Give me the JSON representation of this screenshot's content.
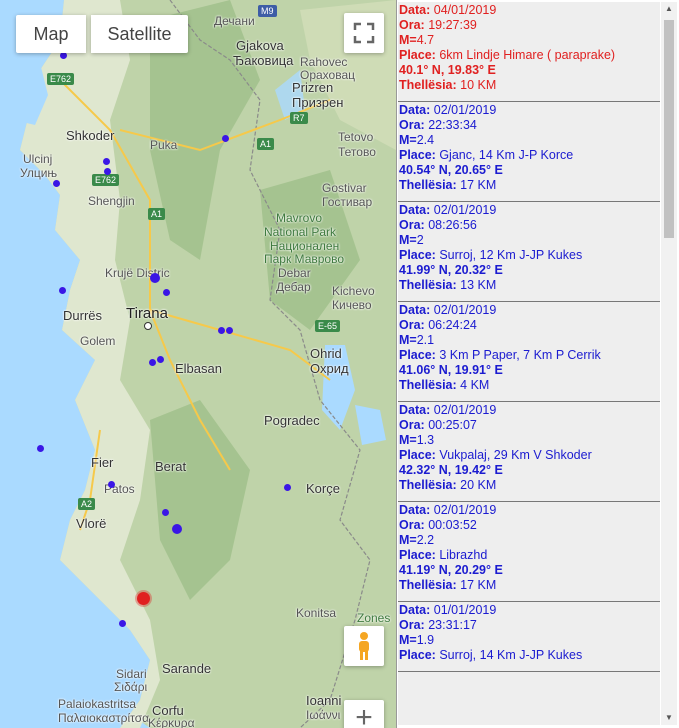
{
  "map": {
    "type_controls": {
      "map": "Map",
      "satellite": "Satellite"
    },
    "zoom_in_label": "+",
    "labels": [
      {
        "name": "place-label-gjakova",
        "text": "Gjakova"
      },
      {
        "name": "place-label-gjakova-cyr",
        "text": "Ђаковица"
      },
      {
        "name": "place-label-decani",
        "text": "Дечани"
      },
      {
        "name": "place-label-rahovec",
        "text": "Rahovec"
      },
      {
        "name": "place-label-rahovec-cyr",
        "text": "Ораховац"
      },
      {
        "name": "place-label-prizren",
        "text": "Prizren"
      },
      {
        "name": "place-label-prizren-cyr",
        "text": "Призрен"
      },
      {
        "name": "place-label-shkoder",
        "text": "Shkoder"
      },
      {
        "name": "place-label-puka",
        "text": "Puka"
      },
      {
        "name": "place-label-ulcinj",
        "text": "Ulcinj"
      },
      {
        "name": "place-label-ulcinj-cyr",
        "text": "Улцињ"
      },
      {
        "name": "place-label-shengjin",
        "text": "Shengjin"
      },
      {
        "name": "place-label-tetovo",
        "text": "Tetovo"
      },
      {
        "name": "place-label-tetovo-cyr",
        "text": "Тетово"
      },
      {
        "name": "place-label-gostivar",
        "text": "Gostivar"
      },
      {
        "name": "place-label-gostivar-cyr",
        "text": "Гостивар"
      },
      {
        "name": "place-label-mavrovo",
        "text": "Mavrovo"
      },
      {
        "name": "place-label-national-park",
        "text": "National Park"
      },
      {
        "name": "place-label-natsionalen",
        "text": "Национален"
      },
      {
        "name": "place-label-park-mavrovo",
        "text": "Парк Маврово"
      },
      {
        "name": "place-label-debar",
        "text": "Debar"
      },
      {
        "name": "place-label-debar-cyr",
        "text": "Дебар"
      },
      {
        "name": "place-label-kruje",
        "text": "Krujë Distric"
      },
      {
        "name": "place-label-kichevo",
        "text": "Kichevo"
      },
      {
        "name": "place-label-kichevo-cyr",
        "text": "Кичево"
      },
      {
        "name": "place-label-durres",
        "text": "Durrës"
      },
      {
        "name": "place-label-tirana",
        "text": "Tirana"
      },
      {
        "name": "place-label-golem",
        "text": "Golem"
      },
      {
        "name": "place-label-ohrid",
        "text": "Ohrid"
      },
      {
        "name": "place-label-ohrid-cyr",
        "text": "Охрид"
      },
      {
        "name": "place-label-elbasan",
        "text": "Elbasan"
      },
      {
        "name": "place-label-pogradec",
        "text": "Pogradec"
      },
      {
        "name": "place-label-fier",
        "text": "Fier"
      },
      {
        "name": "place-label-berat",
        "text": "Berat"
      },
      {
        "name": "place-label-patos",
        "text": "Patos"
      },
      {
        "name": "place-label-korce",
        "text": "Korçe"
      },
      {
        "name": "place-label-vlore",
        "text": "Vlorë"
      },
      {
        "name": "place-label-konitsa",
        "text": "Konitsa"
      },
      {
        "name": "place-label-zones",
        "text": "Zones"
      },
      {
        "name": "place-label-sidari",
        "text": "Sidari"
      },
      {
        "name": "place-label-sidari-gr",
        "text": "Σιδάρι"
      },
      {
        "name": "place-label-sarande",
        "text": "Sarande"
      },
      {
        "name": "place-label-palaiokastritsa",
        "text": "Palaiokastritsa"
      },
      {
        "name": "place-label-palaiokastritsa-gr",
        "text": "Παλαιοκαστρίτσα"
      },
      {
        "name": "place-label-corfu",
        "text": "Corfu"
      },
      {
        "name": "place-label-kerkyra",
        "text": "Κέρκυρα"
      },
      {
        "name": "place-label-ioanni",
        "text": "Ioanni"
      },
      {
        "name": "place-label-ioanni-gr",
        "text": "Ιωάννι"
      }
    ],
    "road_labels": [
      {
        "name": "road-m9",
        "text": "M9"
      },
      {
        "name": "road-e762-north",
        "text": "E762"
      },
      {
        "name": "road-r7",
        "text": "R7"
      },
      {
        "name": "road-a1-east",
        "text": "A1"
      },
      {
        "name": "road-e762-south",
        "text": "E762"
      },
      {
        "name": "road-a1-west",
        "text": "A1"
      },
      {
        "name": "road-e65",
        "text": "E-65"
      },
      {
        "name": "road-a2",
        "text": "A2"
      }
    ]
  },
  "events": [
    {
      "highlight": true,
      "data_label": "Data:",
      "data": "04/01/2019",
      "ora_label": "Ora:",
      "ora": "19:27:39",
      "m_label": "M=",
      "m": "4.7",
      "place_label": "Place:",
      "place": "6km Lindje Himare ( paraprake)",
      "coords": "40.1° N, 19.83° E",
      "depth_label": "Thellësia:",
      "depth": "10 KM"
    },
    {
      "highlight": false,
      "data_label": "Data:",
      "data": "02/01/2019",
      "ora_label": "Ora:",
      "ora": "22:33:34",
      "m_label": "M=",
      "m": "2.4",
      "place_label": "Place:",
      "place": "Gjanc, 14 Km J-P Korce",
      "coords": "40.54° N, 20.65° E",
      "depth_label": "Thellësia:",
      "depth": "17 KM"
    },
    {
      "highlight": false,
      "data_label": "Data:",
      "data": "02/01/2019",
      "ora_label": "Ora:",
      "ora": "08:26:56",
      "m_label": "M=",
      "m": "2",
      "place_label": "Place:",
      "place": "Surroj, 12 Km J-JP Kukes",
      "coords": "41.99° N, 20.32° E",
      "depth_label": "Thellësia:",
      "depth": "13 KM"
    },
    {
      "highlight": false,
      "data_label": "Data:",
      "data": "02/01/2019",
      "ora_label": "Ora:",
      "ora": "06:24:24",
      "m_label": "M=",
      "m": "2.1",
      "place_label": "Place:",
      "place": "3 Km P Paper, 7 Km P Cerrik",
      "coords": "41.06° N, 19.91° E",
      "depth_label": "Thellësia:",
      "depth": "4 KM"
    },
    {
      "highlight": false,
      "data_label": "Data:",
      "data": "02/01/2019",
      "ora_label": "Ora:",
      "ora": "00:25:07",
      "m_label": "M=",
      "m": "1.3",
      "place_label": "Place:",
      "place": "Vukpalaj, 29 Km V Shkoder",
      "coords": "42.32° N, 19.42° E",
      "depth_label": "Thellësia:",
      "depth": "20 KM"
    },
    {
      "highlight": false,
      "data_label": "Data:",
      "data": "02/01/2019",
      "ora_label": "Ora:",
      "ora": "00:03:52",
      "m_label": "M=",
      "m": "2.2",
      "place_label": "Place:",
      "place": "Librazhd",
      "coords": "41.19° N, 20.29° E",
      "depth_label": "Thellësia:",
      "depth": "17 KM"
    },
    {
      "highlight": false,
      "data_label": "Data:",
      "data": "01/01/2019",
      "ora_label": "Ora:",
      "ora": "23:31:17",
      "m_label": "M=",
      "m": "1.9",
      "place_label": "Place:",
      "place": "Surroj, 14 Km J-JP Kukes",
      "coords": "",
      "depth_label": "",
      "depth": ""
    }
  ],
  "colors": {
    "event_text": "#1b1bd0",
    "event_latest": "#e02020",
    "marker": "#3a16e6",
    "marker_latest": "#e02020",
    "list_bg": "#eeeeee"
  }
}
